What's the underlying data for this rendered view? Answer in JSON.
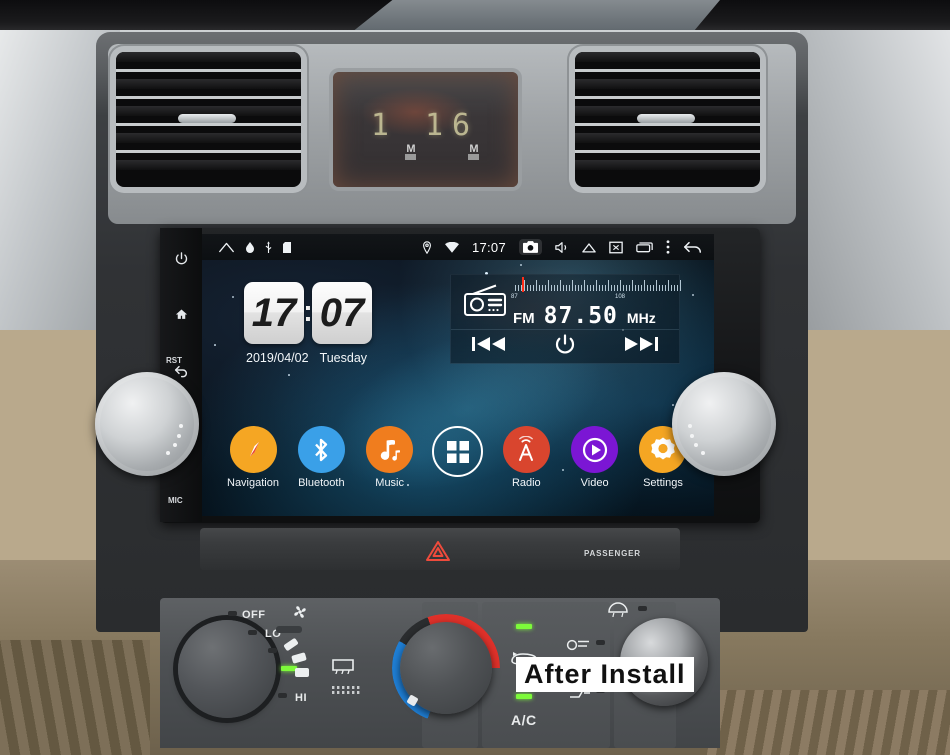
{
  "scene": {
    "title": "Car dashboard with Android head unit installed",
    "watermark": "After Install"
  },
  "dashboard": {
    "clock_pod": {
      "digits": "1 16",
      "marker_left": "M",
      "marker_right": "M"
    },
    "vent_left_name": "air-vent-left",
    "vent_right_name": "air-vent-right",
    "hazard_label": "",
    "passenger_label": "PASSENGER"
  },
  "headunit": {
    "bezel_buttons": [
      {
        "name": "power-button",
        "glyph": "⏻"
      },
      {
        "name": "home-button",
        "glyph": "⌂"
      },
      {
        "name": "back-button",
        "glyph": "↩"
      }
    ],
    "reset_label": "RST",
    "mic_label": "MIC",
    "knob_left_name": "volume-knob-left",
    "knob_right_name": "tune-knob-right"
  },
  "statusbar": {
    "left_icons": [
      "home-icon",
      "dot-icon",
      "usb-icon",
      "sdcard-icon"
    ],
    "location_icon": "location-pin-icon",
    "wifi_icon": "wifi-icon",
    "clock": "17:07",
    "camera_icon": "camera-icon",
    "volume_icon": "volume-icon",
    "eject_icon": "eject-icon",
    "screenshot_icon": "screenshot-icon",
    "recents_icon": "recents-icon",
    "menu_icon": "overflow-menu-icon",
    "back_icon": "back-arrow-icon"
  },
  "clock_widget": {
    "hours": "17",
    "minutes": "07",
    "date": "2019/04/02",
    "weekday": "Tuesday"
  },
  "radio_widget": {
    "icon": "radio-icon",
    "band": "FM",
    "frequency": "87.50",
    "unit": "MHz",
    "scale_min": "87",
    "scale_max": "108",
    "prev_label": "◀◀",
    "power_label": "⏻",
    "next_label": "▶▶"
  },
  "dock": {
    "apps": [
      {
        "label": "Navigation",
        "icon": "compass-icon",
        "color": "#f5a623"
      },
      {
        "label": "Bluetooth",
        "icon": "bluetooth-icon",
        "color": "#3aa0e8"
      },
      {
        "label": "Music",
        "icon": "music-note-icon",
        "color": "#f07d1e"
      },
      {
        "label": "",
        "icon": "apps-grid-icon",
        "color": "transparent"
      },
      {
        "label": "Radio",
        "icon": "radio-tower-icon",
        "color": "#d9452e"
      },
      {
        "label": "Video",
        "icon": "play-icon",
        "color": "#7b16d4"
      },
      {
        "label": "Settings",
        "icon": "gear-icon",
        "color": "#f5a623"
      }
    ]
  },
  "climate": {
    "fan_off": "OFF",
    "fan_lo": "LO",
    "fan_hi": "HI",
    "fan_icon": "fan-icon",
    "rear_defrost_icon": "rear-defrost-icon",
    "recirculate_icon": "recirculate-icon",
    "ac_label": "A/C",
    "mode_icons": [
      "face-vent-icon",
      "face-feet-icon",
      "feet-icon",
      "defrost-icon"
    ]
  }
}
